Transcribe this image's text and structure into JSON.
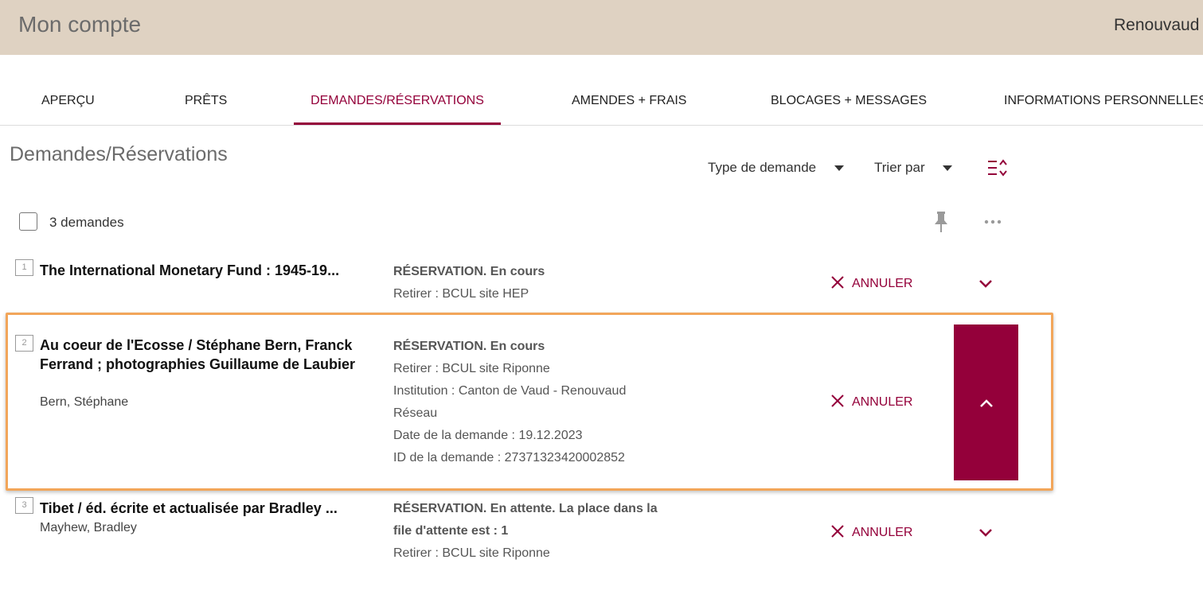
{
  "header": {
    "title": "Mon compte",
    "brand": "Renouvaud"
  },
  "tabs": [
    {
      "label": "APERÇU"
    },
    {
      "label": "PRÊTS"
    },
    {
      "label": "DEMANDES/RÉSERVATIONS",
      "active": true
    },
    {
      "label": "AMENDES + FRAIS"
    },
    {
      "label": "BLOCAGES + MESSAGES"
    },
    {
      "label": "INFORMATIONS PERSONNELLES"
    }
  ],
  "page": {
    "title": "Demandes/Réservations",
    "filter_type": "Type de demande",
    "sort_by": "Trier par",
    "count": "3 demandes"
  },
  "colors": {
    "accent": "#94003a",
    "header_bg": "#dfd2c2",
    "highlight": "#f2a65a"
  },
  "icons": {
    "sort": "sort-list-icon",
    "pin": "pin-icon",
    "more": "more-dots-icon",
    "cancel": "close-x-icon",
    "expand": "chevron-down-icon",
    "collapse": "chevron-up-icon"
  },
  "requests": [
    {
      "num": "1",
      "title": "The International Monetary Fund : 1945-19...",
      "author": "",
      "status": "RÉSERVATION. En cours",
      "lines": [
        "Retirer : BCUL site HEP"
      ],
      "cancel": "ANNULER"
    },
    {
      "num": "2",
      "title": "Au coeur de l'Ecosse / Stéphane Bern, Franck Ferrand ; photographies Guillaume de Laubier",
      "author": "Bern, Stéphane",
      "status": "RÉSERVATION. En cours",
      "lines": [
        "Retirer : BCUL site Riponne",
        "Institution  : Canton de Vaud - Renouvaud",
        "Réseau",
        "Date de la demande : 19.12.2023",
        "ID de la demande : 27371323420002852"
      ],
      "cancel": "ANNULER",
      "expanded": true
    },
    {
      "num": "3",
      "title": "Tibet / éd. écrite et actualisée par Bradley ...",
      "author": "Mayhew, Bradley",
      "status_line1": "RÉSERVATION. En attente. La place dans la",
      "status_line2": "file d'attente est : 1",
      "lines": [
        "Retirer : BCUL site Riponne"
      ],
      "cancel": "ANNULER"
    }
  ]
}
